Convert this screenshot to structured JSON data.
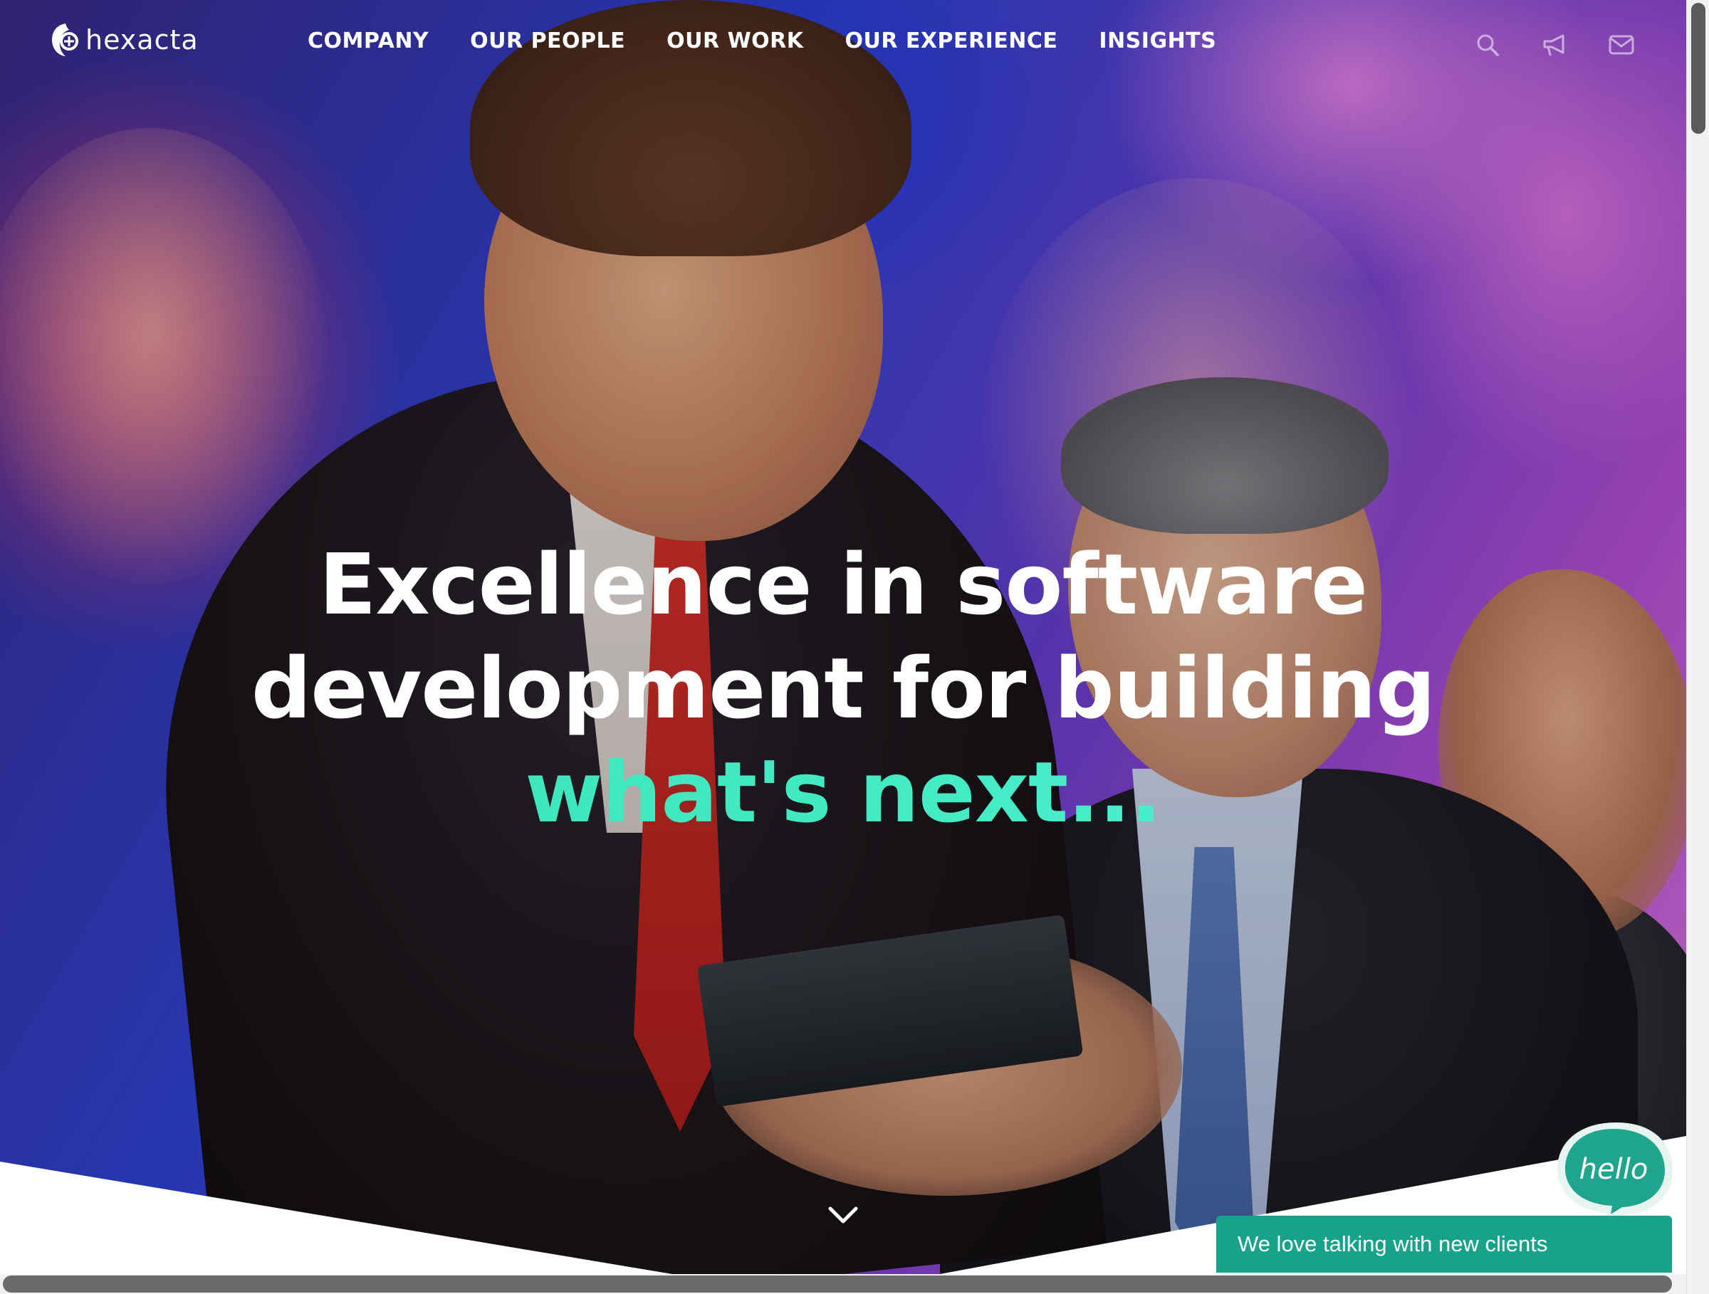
{
  "brand": {
    "logo_text": "hexacta",
    "logo_icon": "hexacta-logo-icon"
  },
  "nav": {
    "items": [
      {
        "label": "COMPANY"
      },
      {
        "label": "OUR PEOPLE"
      },
      {
        "label": "OUR WORK"
      },
      {
        "label": "OUR EXPERIENCE"
      },
      {
        "label": "INSIGHTS"
      }
    ],
    "icons": [
      "search-icon",
      "megaphone-icon",
      "mail-icon"
    ]
  },
  "hero": {
    "headline_line1": "Excellence in software",
    "headline_line2": "development for building",
    "headline_accent": "what's next...",
    "scroll_icon": "chevron-down-icon"
  },
  "chat": {
    "bubble_text": "hello",
    "bar_text": "We love talking with new clients"
  },
  "colors": {
    "accent": "#3ef0c4",
    "chat_green": "#17a38a",
    "text_white": "#ffffff"
  }
}
